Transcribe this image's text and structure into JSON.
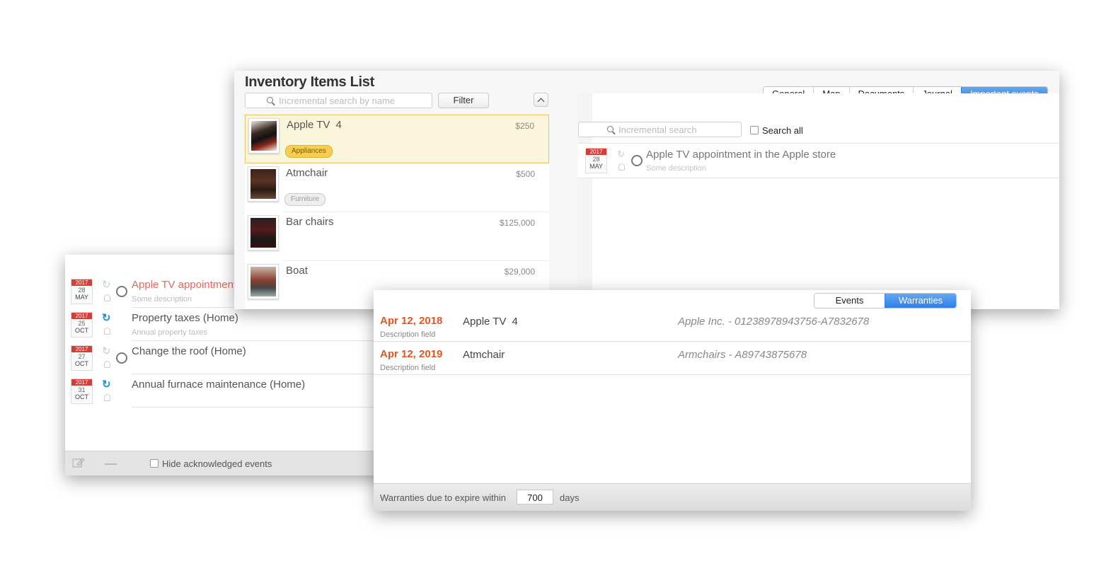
{
  "events_window": {
    "events": [
      {
        "year": "2017",
        "day": "28",
        "month": "MAY",
        "title": "Apple TV appointment",
        "description": "Some description",
        "recurring": false,
        "highlighted": true,
        "has_radio": true
      },
      {
        "year": "2017",
        "day": "25",
        "month": "OCT",
        "title": "Property taxes (Home)",
        "description": "Annual property taxes",
        "recurring": true,
        "highlighted": false,
        "has_radio": false
      },
      {
        "year": "2017",
        "day": "27",
        "month": "OCT",
        "title": "Change the roof (Home)",
        "description": "",
        "recurring": false,
        "highlighted": false,
        "has_radio": true
      },
      {
        "year": "2017",
        "day": "31",
        "month": "OCT",
        "title": "Annual furnace maintenance (Home)",
        "description": "",
        "recurring": true,
        "highlighted": false,
        "has_radio": false
      }
    ],
    "hide_acknowledged_label": "Hide acknowledged events",
    "edit_icon": "pencil-icon",
    "remove_icon": "minus-icon"
  },
  "inventory_window": {
    "title": "Inventory Items List",
    "search_placeholder": "Incremental search by name",
    "filter_label": "Filter",
    "collapse_icon": "chevron-up-icon",
    "items": [
      {
        "name": "Apple TV",
        "name_suffix": "4",
        "price": "$250",
        "tag": "Appliances",
        "tag_style": "yellow"
      },
      {
        "name": "Atmchair",
        "name_suffix": "",
        "price": "$500",
        "tag": "Furniture",
        "tag_style": "grey"
      },
      {
        "name": "Bar chairs",
        "name_suffix": "",
        "price": "$125,000",
        "tag": "",
        "tag_style": ""
      },
      {
        "name": "Boat",
        "name_suffix": "",
        "price": "$29,000",
        "tag": "",
        "tag_style": ""
      }
    ],
    "tabs": [
      "General",
      "Map",
      "Documents",
      "Journal",
      "Important events"
    ],
    "active_tab": "Important events",
    "detail_search_placeholder": "Incremental search",
    "search_all_label": "Search all",
    "detail_event": {
      "year": "2017",
      "day": "28",
      "month": "MAY",
      "title": "Apple TV appointment in the Apple store",
      "description": "Some description"
    }
  },
  "warranties_window": {
    "tabs": [
      "Events",
      "Warranties"
    ],
    "active_tab": "Warranties",
    "rows": [
      {
        "date": "Apr 12, 2018",
        "description": "Description field",
        "item": "Apple TV",
        "item_suffix": "4",
        "info": "Apple Inc. - 01238978943756-A7832678"
      },
      {
        "date": "Apr 12, 2019",
        "description": "Description field",
        "item": "Atmchair",
        "item_suffix": "",
        "info": "Armchairs - A89743875678"
      }
    ],
    "expire_label": "Warranties due to expire within",
    "expire_days": "700",
    "days_label": "days"
  },
  "colors": {
    "accent_blue": "#2f7fe6",
    "warning_orange": "#e8541f",
    "highlight_red": "#e8675a",
    "calendar_red": "#d93b35",
    "tag_yellow": "#f7cd52",
    "recur_blue": "#1f93d6"
  }
}
